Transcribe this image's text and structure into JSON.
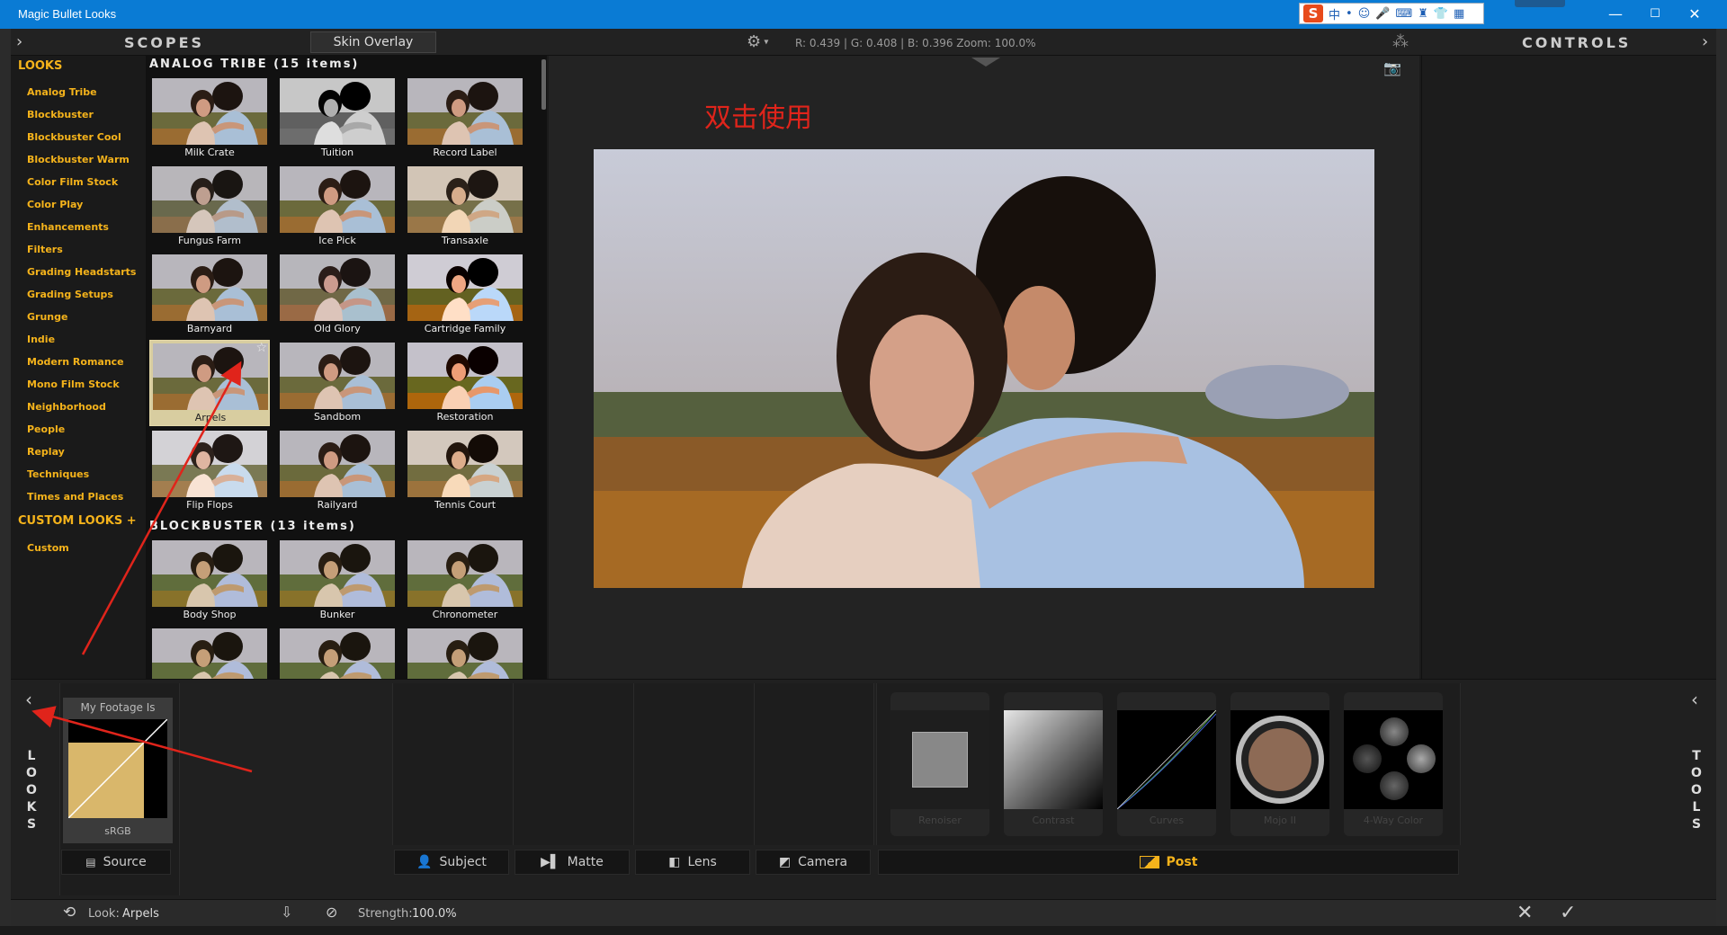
{
  "window": {
    "title": "Magic Bullet Looks",
    "minimize": "—",
    "maximize": "☐",
    "close": "✕"
  },
  "ime": {
    "brand": "S",
    "chinese": "中",
    "glyphs": [
      "•",
      "☺",
      "🎤",
      "⌨",
      "♜",
      "👕",
      "▦"
    ]
  },
  "header": {
    "scopes": "SCOPES",
    "skin_overlay": "Skin Overlay",
    "readout": "R: 0.439 | G: 0.408 | B: 0.396    Zoom: 100.0%",
    "controls": "CONTROLS"
  },
  "sidebar": {
    "looks_title": "LOOKS",
    "categories": [
      "Analog Tribe",
      "Blockbuster",
      "Blockbuster Cool",
      "Blockbuster Warm",
      "Color Film Stock",
      "Color Play",
      "Enhancements",
      "Filters",
      "Grading Headstarts",
      "Grading Setups",
      "Grunge",
      "Indie",
      "Modern Romance",
      "Mono Film Stock",
      "Neighborhood",
      "People",
      "Replay",
      "Techniques",
      "Times and Places"
    ],
    "custom_title": "CUSTOM LOOKS +",
    "custom_items": [
      "Custom"
    ]
  },
  "grid": {
    "section1": "ANALOG TRIBE (15 items)",
    "section2": "BLOCKBUSTER (13 items)",
    "looks1": [
      "Milk Crate",
      "Tuition",
      "Record Label",
      "Fungus Farm",
      "Ice Pick",
      "Transaxle",
      "Barnyard",
      "Old Glory",
      "Cartridge Family",
      "Arpels",
      "Sandbom",
      "Restoration",
      "Flip Flops",
      "Railyard",
      "Tennis Court"
    ],
    "looks2": [
      "Body Shop",
      "Bunker",
      "Chronometer",
      "",
      "",
      ""
    ],
    "selected": "Arpels"
  },
  "viewer": {
    "note": "双击使用"
  },
  "bottom": {
    "looks_vertical": "LOOKS",
    "tools_vertical": "TOOLS",
    "footage_label": "My Footage Is",
    "footage_space": "sRGB",
    "tabs": {
      "source": "Source",
      "subject": "Subject",
      "matte": "Matte",
      "lens": "Lens",
      "camera": "Camera",
      "post": "Post"
    },
    "post_tools": [
      "Renoiser",
      "Contrast",
      "Curves",
      "Mojo II",
      "4-Way Color"
    ]
  },
  "status": {
    "look_label": "Look:",
    "look_value": "Arpels",
    "strength_label": "Strength:",
    "strength_value": "100.0%"
  },
  "colors": {
    "accent": "#f5b31b",
    "titlebar": "#0a7bd4",
    "annotation": "#e0241b"
  }
}
